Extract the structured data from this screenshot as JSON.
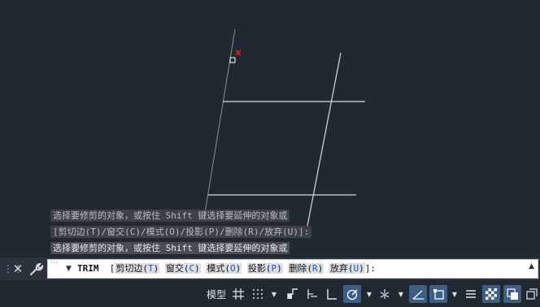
{
  "history": [
    "选择要修剪的对象，或按住 Shift 键选择要延伸的对象或",
    "[剪切边(T)/窗交(C)/模式(O)/投影(P)/删除(R)/放弃(U)]:",
    "选择要修剪的对象，或按住 Shift 键选择要延伸的对象或"
  ],
  "command": {
    "name": "TRIM",
    "open_bracket": "[",
    "close": "]:",
    "options": [
      {
        "label": "剪切边(",
        "key": "T",
        "end": ")"
      },
      {
        "label": "窗交(",
        "key": "C",
        "end": ")"
      },
      {
        "label": "模式(",
        "key": "O",
        "end": ")"
      },
      {
        "label": "投影(",
        "key": "P",
        "end": ")"
      },
      {
        "label": "删除(",
        "key": "R",
        "end": ")"
      },
      {
        "label": "放弃(",
        "key": "U",
        "end": ")"
      }
    ]
  },
  "status": {
    "model_label": "模型",
    "items": [
      "grid-icon",
      "snap-dots-icon",
      "snap-dropdown",
      "infer-icon",
      "dynamic-input-icon",
      "ortho-icon",
      "polar-icon",
      "polar-dropdown",
      "isodraft-icon",
      "isodraft-dropdown",
      "osnap-track-icon",
      "osnap-icon",
      "osnap-dropdown",
      "lineweight-icon",
      "transparency-icon",
      "selection-cycling-icon",
      "annotation-monitor-icon"
    ]
  },
  "colors": {
    "canvas": "#212830",
    "accent": "#3d5f86",
    "cursor_marker": "#e02020",
    "geometry": "#d8dadc"
  }
}
